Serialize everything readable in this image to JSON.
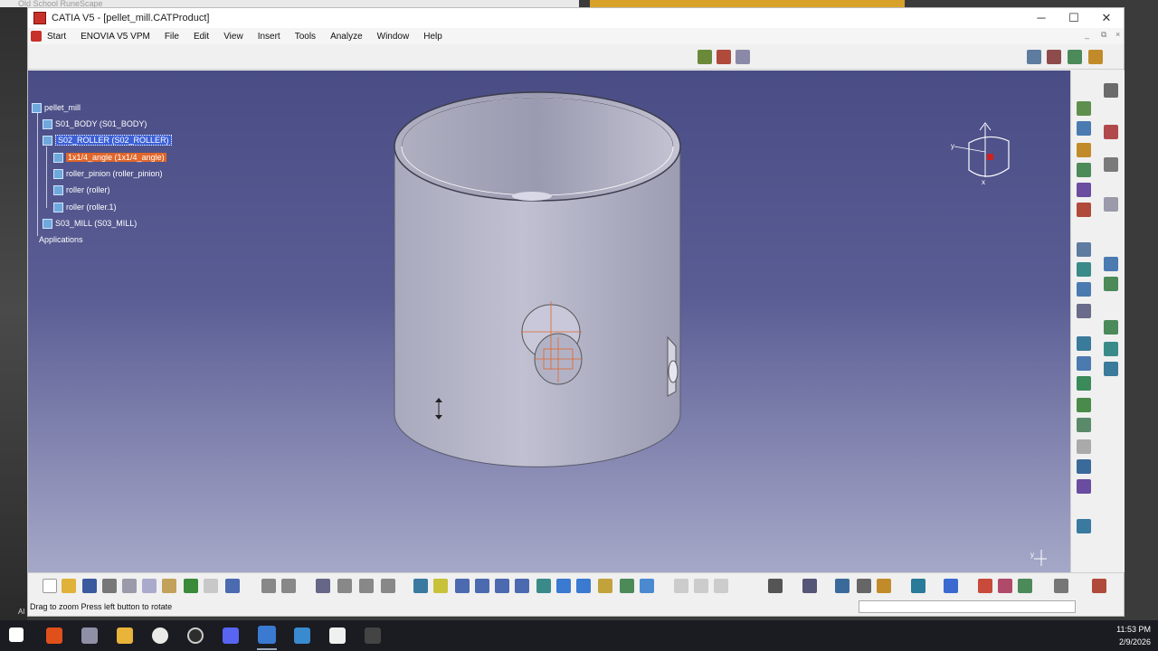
{
  "background": {
    "browser_tab": "Old School RuneScape"
  },
  "window": {
    "title": "CATIA V5 - [pellet_mill.CATProduct]"
  },
  "window_controls": {
    "minimize": "─",
    "maximize": "☐",
    "close": "✕"
  },
  "menu": {
    "items": [
      "Start",
      "ENOVIA V5 VPM",
      "File",
      "Edit",
      "View",
      "Insert",
      "Tools",
      "Analyze",
      "Window",
      "Help"
    ]
  },
  "mdi_controls": [
    "_",
    "⧉",
    "×"
  ],
  "tree": {
    "root": "pellet_mill",
    "items": [
      {
        "label": "S01_BODY (S01_BODY)",
        "level": 1,
        "state": "normal"
      },
      {
        "label": "S02_ROLLER (S02_ROLLER)",
        "level": 1,
        "state": "selected"
      },
      {
        "label": "1x1/4_angle (1x1/4_angle)",
        "level": 2,
        "state": "highlighted"
      },
      {
        "label": "roller_pinion (roller_pinion)",
        "level": 2,
        "state": "normal"
      },
      {
        "label": "roller (roller)",
        "level": 2,
        "state": "normal"
      },
      {
        "label": "roller (roller.1)",
        "level": 2,
        "state": "normal"
      },
      {
        "label": "S03_MILL (S03_MILL)",
        "level": 1,
        "state": "normal"
      }
    ],
    "footer": "Applications"
  },
  "compass": {
    "x_label": "x",
    "y_label": "y"
  },
  "axis_mini": {
    "label": "y"
  },
  "statusbar": {
    "text": "Drag to zoom  Press left button to rotate",
    "left_edge": "Al"
  },
  "taskbar": {
    "time": "11:53 PM",
    "date": "2/9/2026",
    "apps": [
      "start",
      "brave",
      "tool",
      "files",
      "obs",
      "chrome",
      "discord",
      "catia",
      "calculator",
      "app",
      "steam"
    ]
  },
  "colors": {
    "viewport_top": "#4a4d85",
    "viewport_bottom": "#a6a8c8",
    "selection": "#3b5fd6",
    "highlight": "#e0662a",
    "model": "#b7b7c7"
  }
}
